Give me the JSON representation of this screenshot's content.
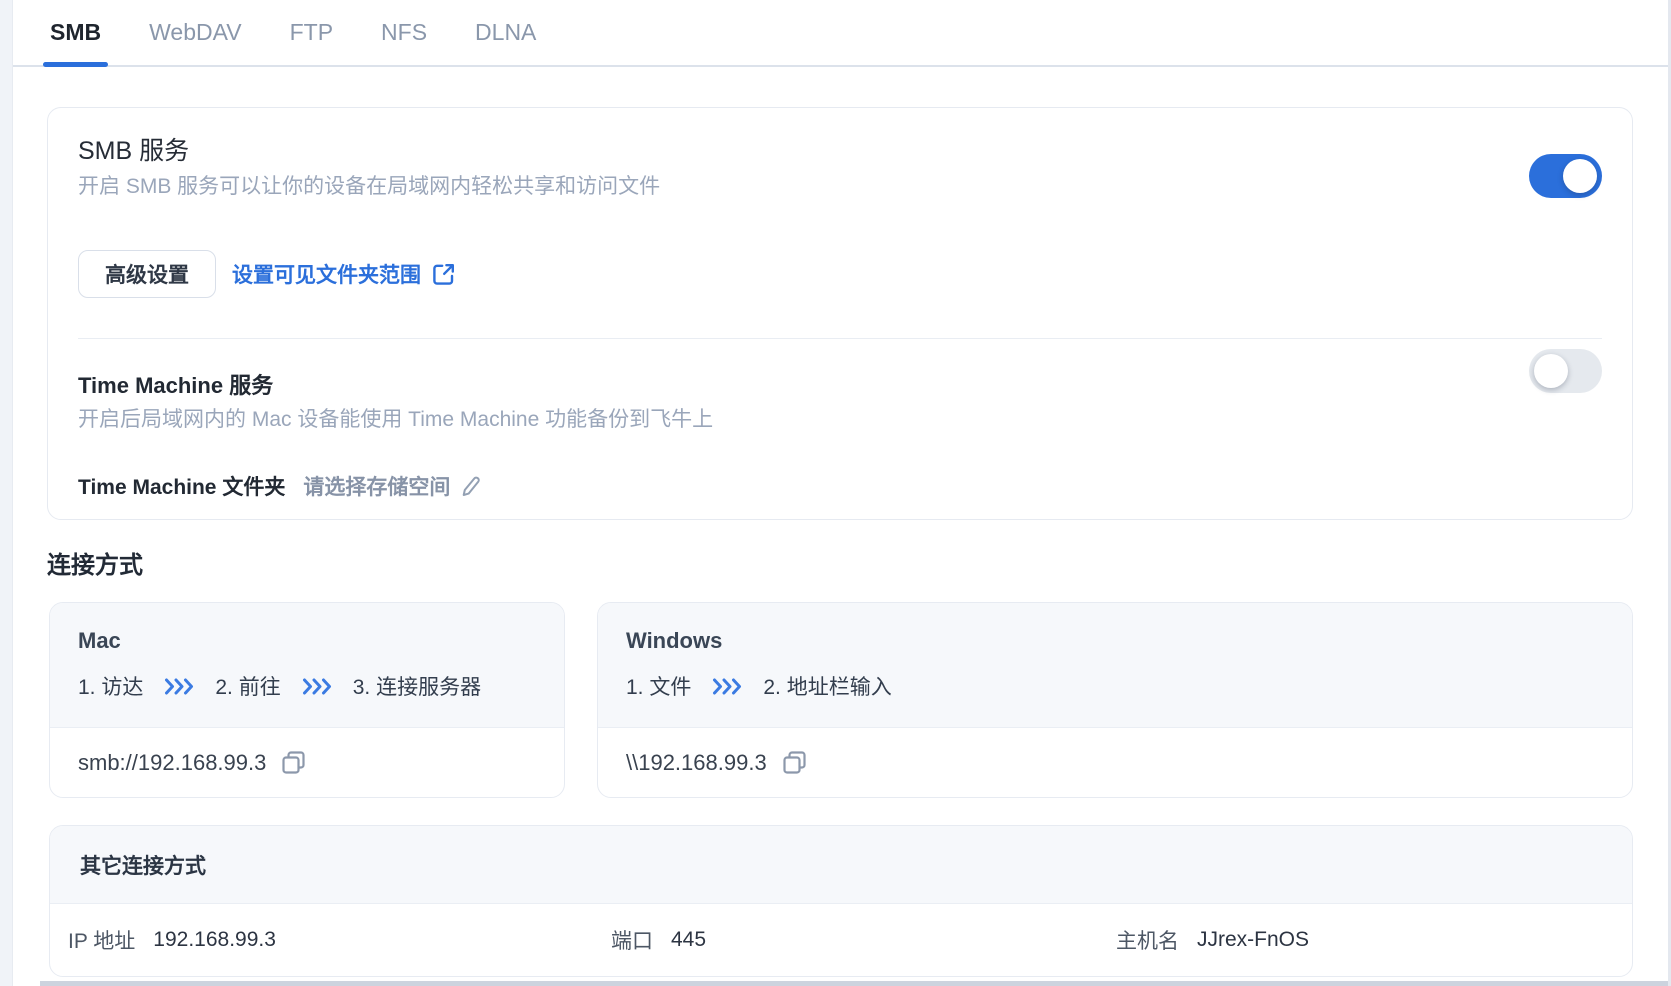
{
  "tabs": [
    {
      "label": "SMB",
      "active": true
    },
    {
      "label": "WebDAV",
      "active": false
    },
    {
      "label": "FTP",
      "active": false
    },
    {
      "label": "NFS",
      "active": false
    },
    {
      "label": "DLNA",
      "active": false
    }
  ],
  "smb_service": {
    "title": "SMB 服务",
    "description": "开启 SMB 服务可以让你的设备在局域网内轻松共享和访问文件",
    "enabled": true,
    "advanced_button_label": "高级设置",
    "visible_folders_link_label": "设置可见文件夹范围"
  },
  "time_machine": {
    "title": "Time Machine 服务",
    "description": "开启后局域网内的 Mac 设备能使用 Time Machine 功能备份到飞牛上",
    "enabled": false,
    "folder_label": "Time Machine 文件夹",
    "folder_placeholder": "请选择存储空间"
  },
  "connection": {
    "heading": "连接方式",
    "mac": {
      "title": "Mac",
      "steps": [
        "1. 访达",
        "2. 前往",
        "3. 连接服务器"
      ],
      "address": "smb://192.168.99.3"
    },
    "windows": {
      "title": "Windows",
      "steps": [
        "1. 文件",
        "2. 地址栏输入"
      ],
      "address": "\\\\192.168.99.3"
    },
    "other": {
      "title": "其它连接方式",
      "fields": [
        {
          "label": "IP 地址",
          "value": "192.168.99.3"
        },
        {
          "label": "端口",
          "value": "445"
        },
        {
          "label": "主机名",
          "value": "JJrex-FnOS"
        }
      ]
    }
  },
  "colors": {
    "accent_blue": "#2b6fdb",
    "toggle_off_gray": "#e5e9ee",
    "panel_header_bg": "#f6f8fb"
  }
}
